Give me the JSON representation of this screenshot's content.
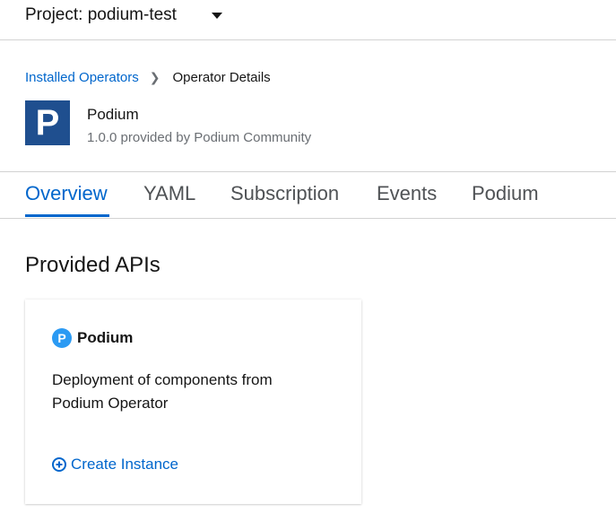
{
  "project": {
    "label": "Project: podium-test"
  },
  "breadcrumb": {
    "parent": "Installed Operators",
    "current": "Operator Details"
  },
  "operator": {
    "logo_letter": "P",
    "name": "Podium",
    "subtitle": "1.0.0 provided by Podium Community",
    "logo_color": "#1f4f8f"
  },
  "tabs": [
    {
      "label": "Overview",
      "active": true
    },
    {
      "label": "YAML",
      "active": false
    },
    {
      "label": "Subscription",
      "active": false
    },
    {
      "label": "Events",
      "active": false
    },
    {
      "label": "Podium",
      "active": false
    }
  ],
  "section": {
    "title": "Provided APIs"
  },
  "api_card": {
    "icon_letter": "P",
    "name": "Podium",
    "description": "Deployment of components from Podium Operator",
    "create_label": "Create Instance",
    "icon_color": "#2b9af3",
    "link_color": "#0066cc"
  }
}
